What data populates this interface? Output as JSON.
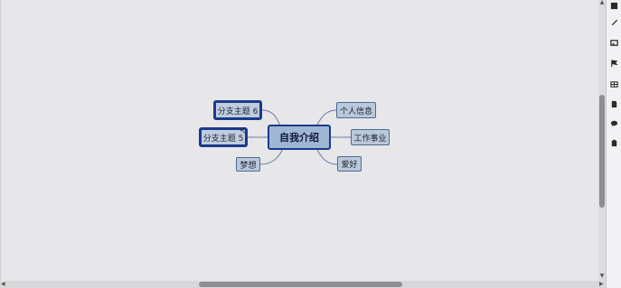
{
  "mindmap": {
    "central": "自我介绍",
    "left_nodes": [
      {
        "label": "分支主题 6"
      },
      {
        "label": "分支主题 5"
      },
      {
        "label": "梦想"
      }
    ],
    "right_nodes": [
      {
        "label": "个人信息"
      },
      {
        "label": "工作事业"
      },
      {
        "label": "爱好"
      }
    ]
  },
  "colors": {
    "canvas": "#e7e6e8",
    "node_fill": "#b9c8da",
    "central_fill": "#9fb7d3",
    "border_dark": "#1a3a8c",
    "connector": "#6b7fa6"
  },
  "toolbar": {
    "icons": [
      "settings-icon",
      "brush-icon",
      "image-icon",
      "flag-icon",
      "table-icon",
      "note-icon",
      "comment-icon",
      "clipboard-icon"
    ]
  }
}
